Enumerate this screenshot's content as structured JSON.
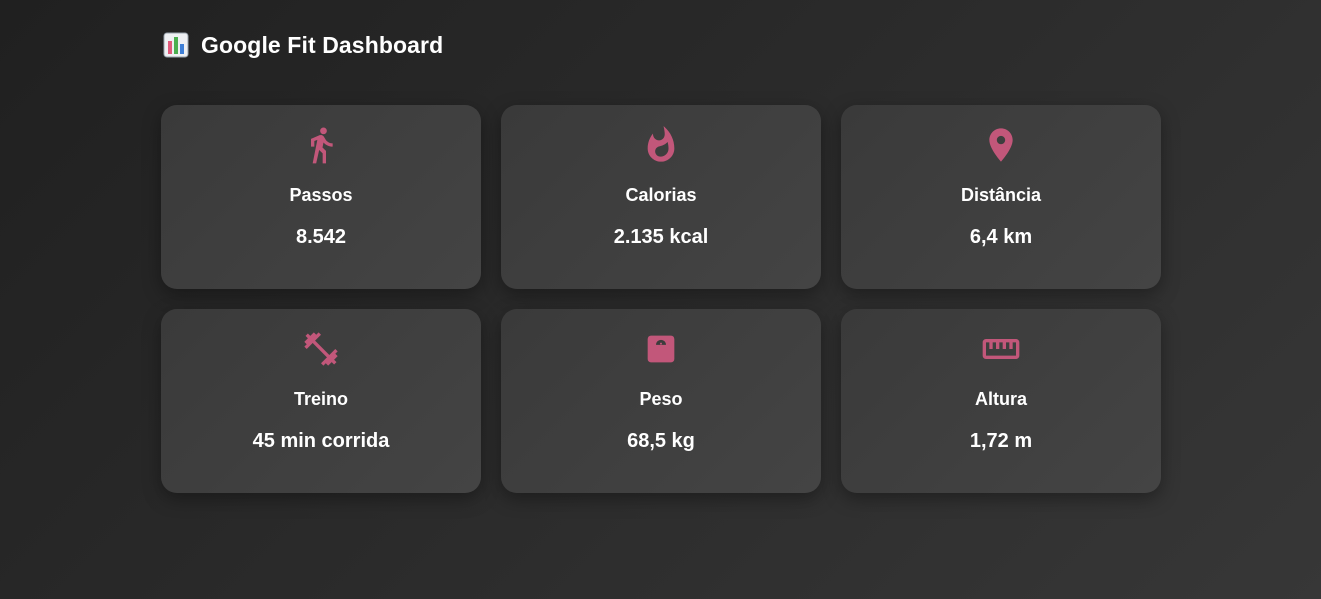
{
  "header": {
    "title": "Google Fit Dashboard",
    "icon": "bar-chart-icon"
  },
  "accent_color": "#c2577a",
  "cards": [
    {
      "icon": "walking-icon",
      "label": "Passos",
      "value": "8.542"
    },
    {
      "icon": "flame-icon",
      "label": "Calorias",
      "value": "2.135 kcal"
    },
    {
      "icon": "location-pin-icon",
      "label": "Distância",
      "value": "6,4 km"
    },
    {
      "icon": "dumbbell-icon",
      "label": "Treino",
      "value": "45 min corrida"
    },
    {
      "icon": "scale-icon",
      "label": "Peso",
      "value": "68,5 kg"
    },
    {
      "icon": "ruler-icon",
      "label": "Altura",
      "value": "1,72 m"
    }
  ]
}
